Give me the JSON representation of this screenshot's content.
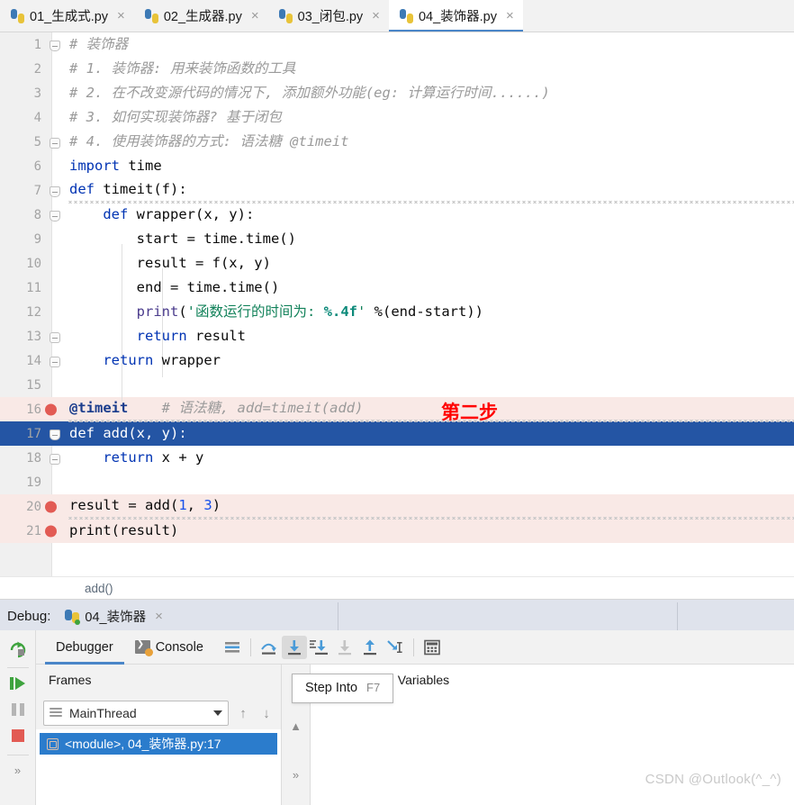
{
  "tabs": [
    {
      "label": "01_生成式.py",
      "active": false
    },
    {
      "label": "02_生成器.py",
      "active": false
    },
    {
      "label": "03_闭包.py",
      "active": false
    },
    {
      "label": "04_装饰器.py",
      "active": true
    }
  ],
  "tab_close_glyph": "×",
  "editor": {
    "lines": [
      {
        "no": "1",
        "fold": "pointy",
        "bp": false,
        "cur": false
      },
      {
        "no": "2",
        "fold": "",
        "bp": false,
        "cur": false
      },
      {
        "no": "3",
        "fold": "",
        "bp": false,
        "cur": false
      },
      {
        "no": "4",
        "fold": "",
        "bp": false,
        "cur": false
      },
      {
        "no": "5",
        "fold": "round",
        "bp": false,
        "cur": false
      },
      {
        "no": "6",
        "fold": "",
        "bp": false,
        "cur": false
      },
      {
        "no": "7",
        "fold": "pointy",
        "bp": false,
        "cur": false
      },
      {
        "no": "8",
        "fold": "pointy",
        "bp": false,
        "cur": false
      },
      {
        "no": "9",
        "fold": "",
        "bp": false,
        "cur": false
      },
      {
        "no": "10",
        "fold": "",
        "bp": false,
        "cur": false
      },
      {
        "no": "11",
        "fold": "",
        "bp": false,
        "cur": false
      },
      {
        "no": "12",
        "fold": "",
        "bp": false,
        "cur": false
      },
      {
        "no": "13",
        "fold": "round",
        "bp": false,
        "cur": false
      },
      {
        "no": "14",
        "fold": "round",
        "bp": false,
        "cur": false
      },
      {
        "no": "15",
        "fold": "",
        "bp": false,
        "cur": false
      },
      {
        "no": "16",
        "fold": "",
        "bp": true,
        "cur": false
      },
      {
        "no": "17",
        "fold": "pointy",
        "bp": false,
        "cur": true
      },
      {
        "no": "18",
        "fold": "round",
        "bp": false,
        "cur": false
      },
      {
        "no": "19",
        "fold": "",
        "bp": false,
        "cur": false
      },
      {
        "no": "20",
        "fold": "",
        "bp": true,
        "cur": false
      },
      {
        "no": "21",
        "fold": "",
        "bp": true,
        "cur": false
      }
    ],
    "code": {
      "l1": "# 装饰器",
      "l2": "# 1. 装饰器: 用来装饰函数的工具",
      "l3": "# 2. 在不改变源代码的情况下, 添加额外功能(eg: 计算运行时间......)",
      "l4": "# 3. 如何实现装饰器? 基于闭包",
      "l5": "# 4. 使用装饰器的方式: 语法糖 @timeit",
      "l6_kw": "import",
      "l6_rest": " time",
      "l7_kw": "def",
      "l7_rest": " timeit(f):",
      "l8_kw": "def",
      "l8_rest": " wrapper(x, y):",
      "l9": "start = time.time()",
      "l10": "result = f(x, y)",
      "l11": "end = time.time()",
      "l12_fn": "print",
      "l12_p1": "(",
      "l12_str": "'函数运行的时间为: ",
      "l12_fmt": "%.4f",
      "l12_str2": "'",
      "l12_rest": " %(end-start))",
      "l13_kw": "return",
      "l13_rest": " result",
      "l14_kw": "return",
      "l14_rest": " wrapper",
      "l16_dec": "@timeit",
      "l16_gap": "    ",
      "l16_cm": "# 语法糖, add=timeit(add)",
      "l16_note": "第二步",
      "l17_kw": "def",
      "l17_rest": " add(x, y):",
      "l18_kw": "return",
      "l18_rest": " x + y",
      "l20_a": "result = add(",
      "l20_n1": "1",
      "l20_b": ", ",
      "l20_n2": "3",
      "l20_c": ")",
      "l21": "print(result)"
    }
  },
  "breadcrumb": {
    "text": "add()"
  },
  "debug_title": {
    "label": "Debug:",
    "config_name": "04_装饰器",
    "close_glyph": "×"
  },
  "debug_toolbar": {
    "tabs": [
      {
        "label": "Debugger",
        "active": true
      },
      {
        "label": "Console",
        "active": false
      }
    ],
    "icons": [
      {
        "name": "mute-breakpoints-icon",
        "state": "normal"
      },
      {
        "name": "step-over-icon",
        "state": "normal"
      },
      {
        "name": "step-into-icon",
        "state": "active"
      },
      {
        "name": "force-step-into-icon",
        "state": "normal"
      },
      {
        "name": "step-out-disabled-icon",
        "state": "disabled"
      },
      {
        "name": "step-up-icon",
        "state": "normal"
      },
      {
        "name": "run-to-cursor-icon",
        "state": "normal"
      },
      {
        "name": "evaluate-expression-icon",
        "state": "normal"
      }
    ]
  },
  "debug_side": {
    "icons": [
      {
        "name": "rerun-icon"
      },
      {
        "name": "resume-icon"
      },
      {
        "name": "pause-icon"
      },
      {
        "name": "stop-icon"
      }
    ],
    "more_glyph": "»"
  },
  "frames": {
    "header": "Frames",
    "thread": "MainThread",
    "up_glyph": "↑",
    "down_glyph": "↓",
    "items": [
      {
        "label": "<module>, 04_装饰器.py:17",
        "selected": true
      }
    ]
  },
  "variables": {
    "gutter": {
      "add_glyph": "+",
      "remove_glyph": "−",
      "up_glyph": "▲",
      "more_glyph": "»"
    },
    "rows": [
      {
        "chevron": "›",
        "label": "Special Variables"
      }
    ]
  },
  "tooltip": {
    "label": "Step Into",
    "shortcut": "F7"
  },
  "watermark": {
    "text": "CSDN @Outlook(^_^)"
  },
  "colors": {
    "accent_blue": "#4a86c8",
    "current_line": "#2455a4",
    "breakpoint_line": "#f9e9e6",
    "breakpoint_dot": "#e25b54",
    "selection_blue": "#2b7ccc",
    "annotation_red": "#ff0000"
  }
}
